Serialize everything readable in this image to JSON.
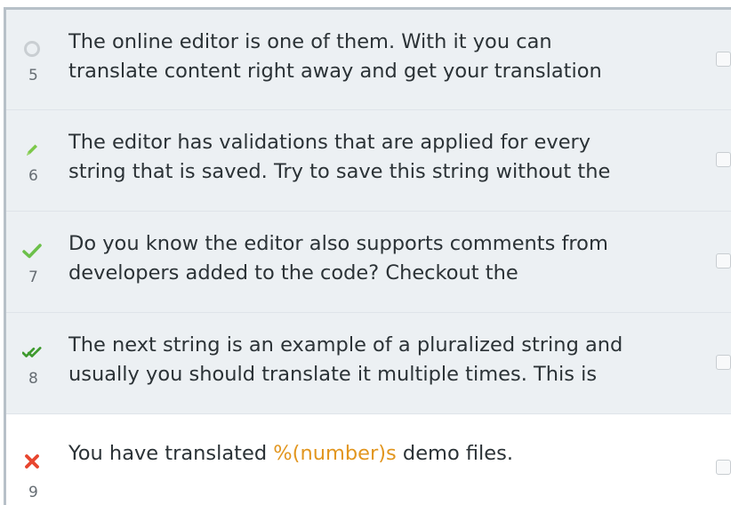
{
  "rows": [
    {
      "number": "5",
      "status": "untranslated-circle-icon",
      "lines": [
        "The online editor is one of them. With it you can",
        "translate content right away and get your translation"
      ]
    },
    {
      "number": "6",
      "status": "pencil-icon",
      "lines": [
        "The editor has validations that are applied for every",
        "string that is saved. Try to save this string without the"
      ]
    },
    {
      "number": "7",
      "status": "check-icon",
      "lines": [
        "Do you know the editor also supports comments from",
        "developers added to the code? Checkout the"
      ]
    },
    {
      "number": "8",
      "status": "double-check-icon",
      "lines": [
        "The next string is an example of a pluralized string and",
        "usually you should translate it multiple times. This is"
      ]
    },
    {
      "number": "9",
      "status": "cross-icon",
      "prefix": "You have translated ",
      "variable": "%(number)s",
      "suffix": " demo files."
    }
  ],
  "colors": {
    "row_background": "#ecf0f3",
    "active_background": "#ffffff",
    "pencil": "#7cc84a",
    "check": "#6cc04a",
    "double_check": "#3e9a2e",
    "cross": "#e8462f",
    "variable": "#e2961f"
  }
}
